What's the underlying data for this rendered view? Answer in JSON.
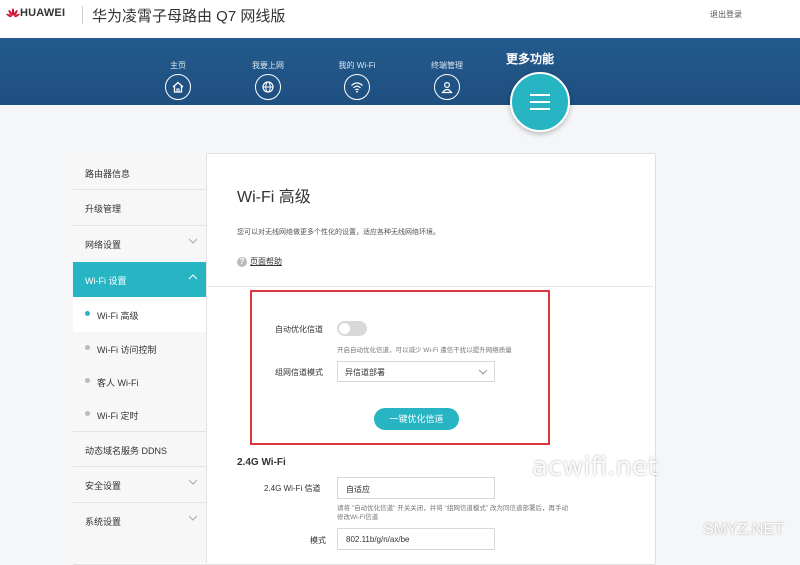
{
  "header": {
    "brand": "HUAWEI",
    "product_title": "华为凌霄子母路由 Q7 网线版",
    "logout": "退出登录"
  },
  "nav": {
    "items": [
      {
        "label": "主页",
        "icon": "home-icon"
      },
      {
        "label": "我要上网",
        "icon": "globe-icon"
      },
      {
        "label": "我的 Wi-Fi",
        "icon": "wifi-icon"
      },
      {
        "label": "终端管理",
        "icon": "user-icon"
      }
    ],
    "more": {
      "label": "更多功能",
      "icon": "menu-icon"
    }
  },
  "sidebar": {
    "items": [
      {
        "label": "路由器信息"
      },
      {
        "label": "升级管理"
      },
      {
        "label": "网络设置"
      },
      {
        "label": "Wi-Fi 设置"
      },
      {
        "label": "Wi-Fi 高级"
      },
      {
        "label": "Wi-Fi 访问控制"
      },
      {
        "label": "客人 Wi-Fi"
      },
      {
        "label": "Wi-Fi 定时"
      },
      {
        "label": "动态域名服务 DDNS"
      },
      {
        "label": "安全设置"
      },
      {
        "label": "系统设置"
      }
    ]
  },
  "main": {
    "title": "Wi-Fi 高级",
    "description": "您可以对无线网络做更多个性化的设置，适应各种无线网络环境。",
    "help": "页面帮助",
    "auto_channel": {
      "label": "自动优化信道",
      "enabled": false,
      "hint": "开启自动优化信道，可以减少 Wi-Fi 遭信干扰以提升网络质量"
    },
    "mesh_channel": {
      "label": "组网信道模式",
      "value": "异信道部署"
    },
    "optimize_button": "一键优化信道",
    "section_24g": {
      "title": "2.4G Wi-Fi",
      "channel_label": "2.4G Wi-Fi 信道",
      "channel_value": "自适应",
      "channel_hint_1": "请将 \"自动优化信道\" 开关关闭，并将 \"组网信道模式\" 改为同信道部署后，再手动",
      "channel_hint_2": "修改Wi-Fi信道",
      "mode_label": "模式",
      "mode_value": "802.11b/g/n/ax/be"
    }
  },
  "watermarks": {
    "site1": "acwifi.net",
    "site2": "SMYZ.NET"
  },
  "colors": {
    "accent": "#27b5c4",
    "nav_bg": "#245a8c",
    "highlight_box": "#d9363e",
    "brand_red": "#cf0a2c"
  }
}
